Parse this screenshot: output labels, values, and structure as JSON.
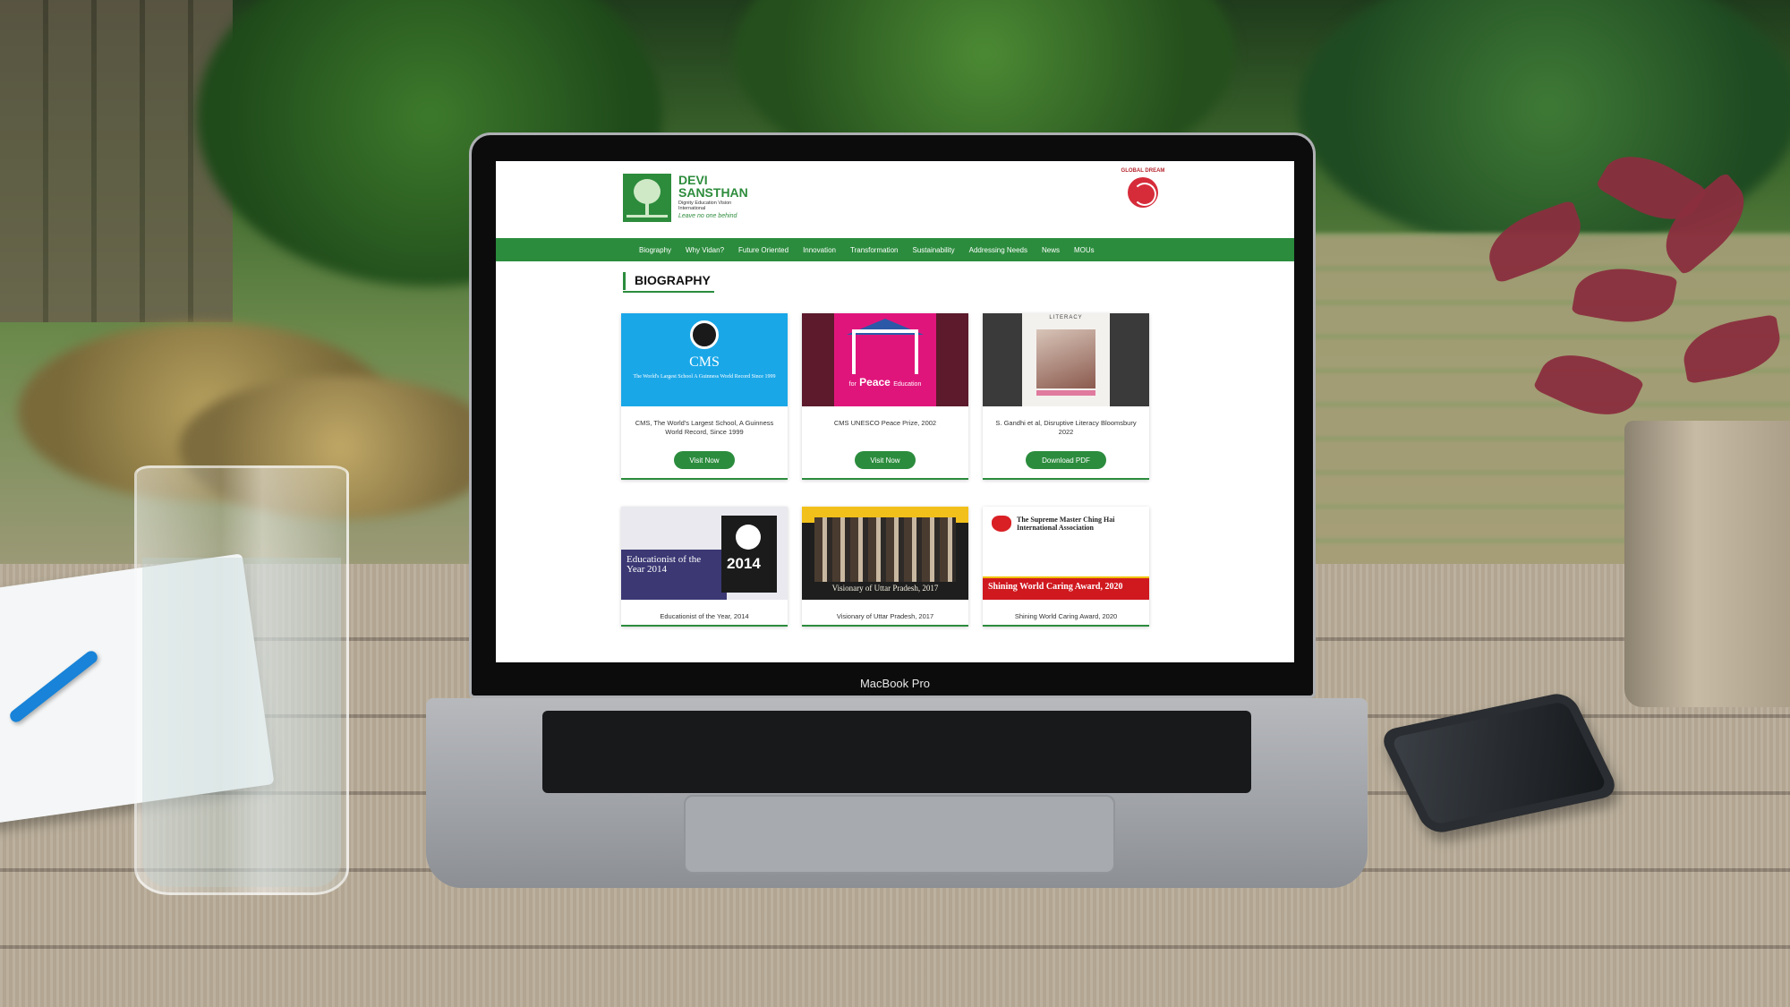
{
  "device": {
    "brand_label": "MacBook Pro"
  },
  "site": {
    "logo": {
      "name_line1": "DEVI",
      "name_line2": "SANSTHAN",
      "subtitle": "Dignity Education Vision International",
      "tagline": "Leave no one behind"
    },
    "badge": {
      "text": "GLOBAL DREAM"
    },
    "nav": {
      "items": [
        "Biography",
        "Why Vidan?",
        "Future Oriented",
        "Innovation",
        "Transformation",
        "Sustainability",
        "Addressing Needs",
        "News",
        "MOUs"
      ]
    },
    "page_title": "BIOGRAPHY",
    "cards": [
      {
        "caption": "CMS, The World's Largest School, A Guinness World Record, Since 1999",
        "button": "Visit Now",
        "image_text": {
          "big": "CMS",
          "small": "The World's Largest School A Guinness World Record Since 1999"
        }
      },
      {
        "caption": "CMS UNESCO Peace Prize, 2002",
        "button": "Visit Now",
        "image_text": {
          "big": "Peace",
          "small": "for",
          "small2": "Education"
        }
      },
      {
        "caption": "S. Gandhi et al, Disruptive Literacy Bloomsbury 2022",
        "button": "Download PDF",
        "image_text": {
          "head": "LITERACY"
        }
      },
      {
        "caption": "Educationist of the Year, 2014",
        "button": "",
        "image_text": {
          "big": "Educationist of the Year 2014",
          "year": "2014"
        }
      },
      {
        "caption": "Visionary of Uttar Pradesh, 2017",
        "button": "",
        "image_text": {
          "big": "Visionary of Uttar Pradesh, 2017"
        }
      },
      {
        "caption": "Shining World Caring Award, 2020",
        "button": "",
        "image_text": {
          "org": "The Supreme Master Ching Hai International Association",
          "big": "Shining World Caring Award, 2020"
        }
      }
    ]
  },
  "colors": {
    "brand_green": "#2b8c3d",
    "cms_blue": "#1aa7e8",
    "peace_pink": "#e0157c",
    "edu_navy": "#3b3874",
    "shine_red": "#d0181f"
  }
}
